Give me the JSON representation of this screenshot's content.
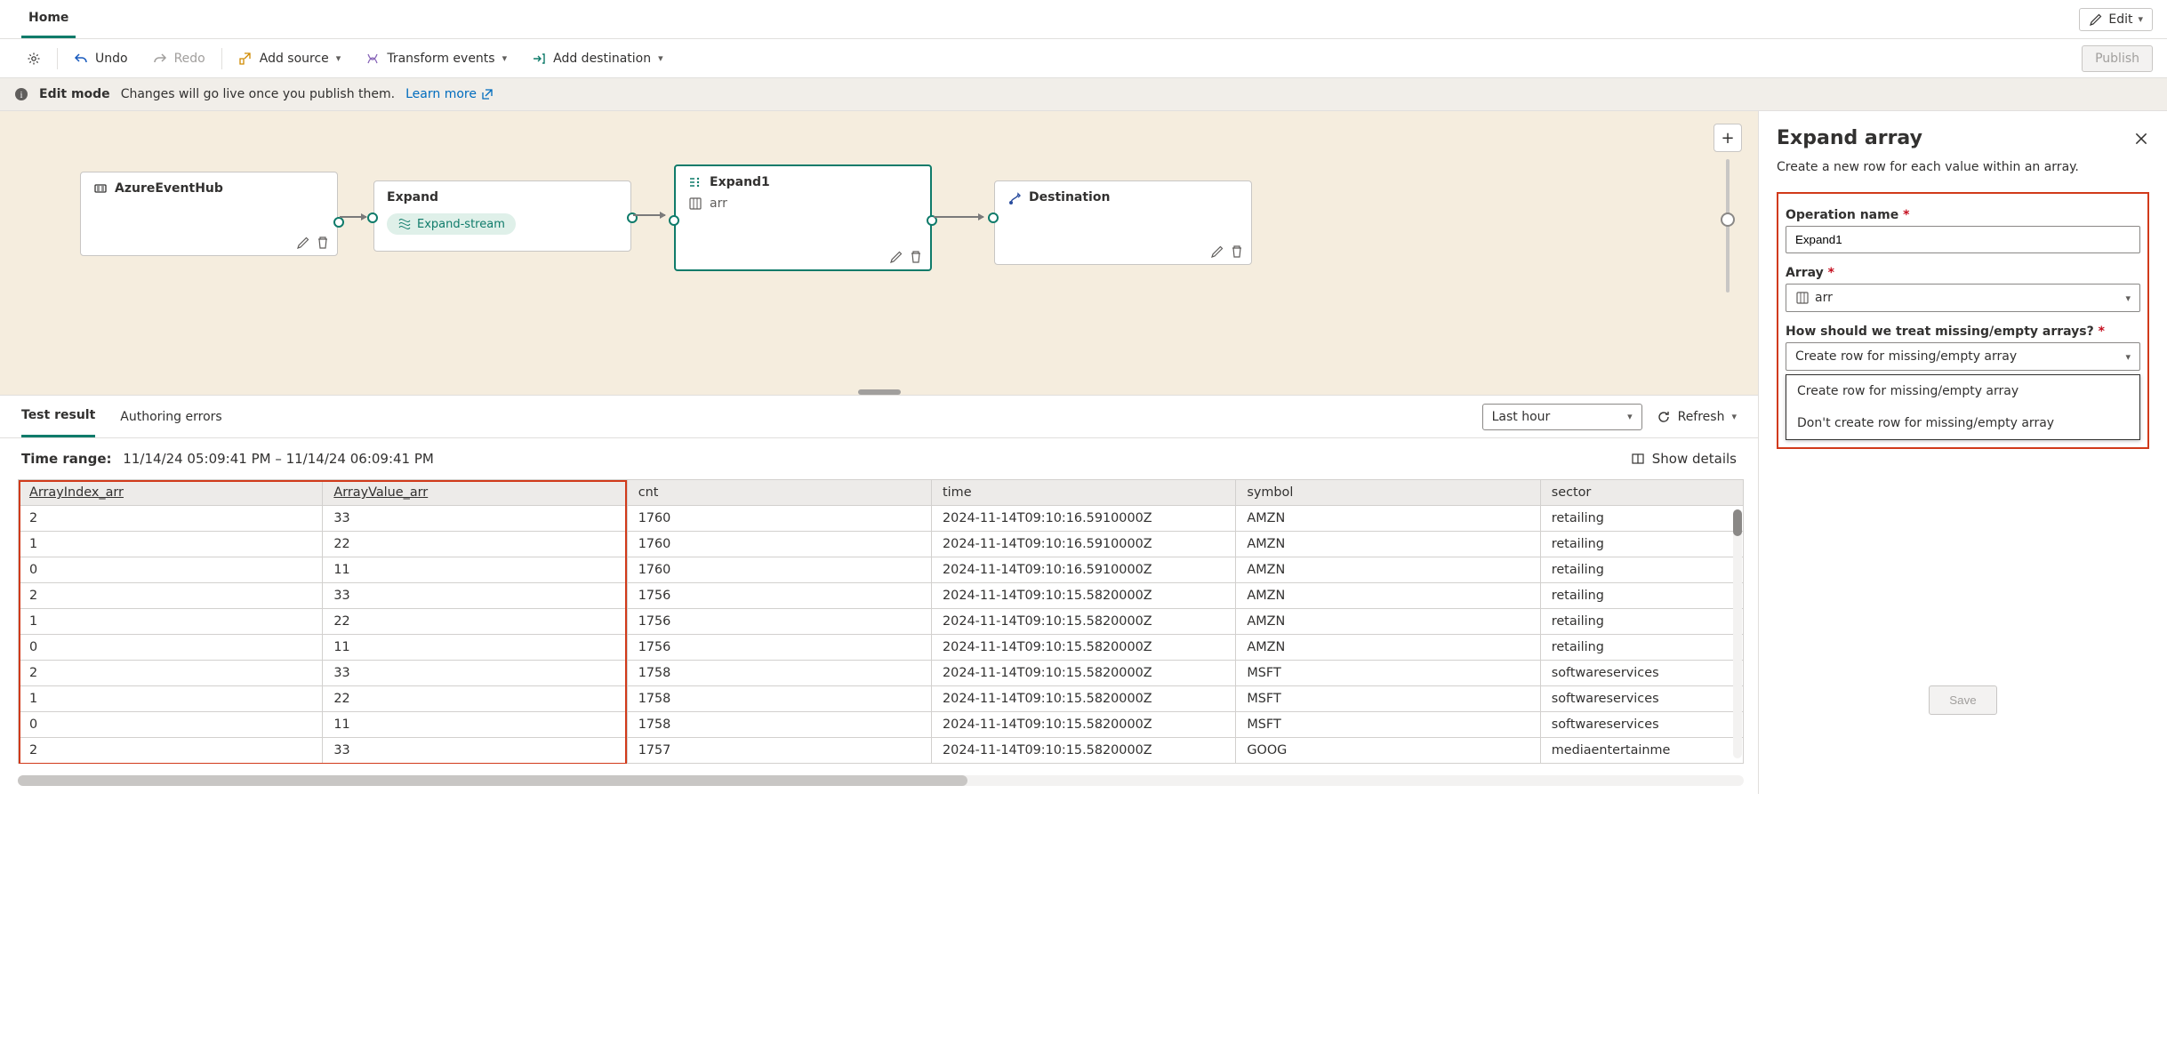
{
  "top": {
    "home_tab": "Home",
    "edit_btn": "Edit"
  },
  "cmd": {
    "undo": "Undo",
    "redo": "Redo",
    "add_source": "Add source",
    "transform": "Transform events",
    "add_dest": "Add destination",
    "publish": "Publish"
  },
  "banner": {
    "title": "Edit mode",
    "body": "Changes will go live once you publish them.",
    "learn_more": "Learn more"
  },
  "canvas": {
    "source": {
      "title": "AzureEventHub"
    },
    "expand_group": {
      "title": "Expand",
      "chip": "Expand-stream"
    },
    "expand1": {
      "title": "Expand1",
      "sub": "arr"
    },
    "destination": {
      "title": "Destination"
    }
  },
  "results": {
    "tabs": {
      "test": "Test result",
      "errors": "Authoring errors"
    },
    "time_select": "Last hour",
    "refresh": "Refresh",
    "time_label": "Time range:",
    "time_range": "11/14/24 05:09:41 PM – 11/14/24 06:09:41 PM",
    "show_details": "Show details",
    "columns": [
      "ArrayIndex_arr",
      "ArrayValue_arr",
      "cnt",
      "time",
      "symbol",
      "sector"
    ],
    "rows": [
      [
        "2",
        "33",
        "1760",
        "2024-11-14T09:10:16.5910000Z",
        "AMZN",
        "retailing"
      ],
      [
        "1",
        "22",
        "1760",
        "2024-11-14T09:10:16.5910000Z",
        "AMZN",
        "retailing"
      ],
      [
        "0",
        "11",
        "1760",
        "2024-11-14T09:10:16.5910000Z",
        "AMZN",
        "retailing"
      ],
      [
        "2",
        "33",
        "1756",
        "2024-11-14T09:10:15.5820000Z",
        "AMZN",
        "retailing"
      ],
      [
        "1",
        "22",
        "1756",
        "2024-11-14T09:10:15.5820000Z",
        "AMZN",
        "retailing"
      ],
      [
        "0",
        "11",
        "1756",
        "2024-11-14T09:10:15.5820000Z",
        "AMZN",
        "retailing"
      ],
      [
        "2",
        "33",
        "1758",
        "2024-11-14T09:10:15.5820000Z",
        "MSFT",
        "softwareservices"
      ],
      [
        "1",
        "22",
        "1758",
        "2024-11-14T09:10:15.5820000Z",
        "MSFT",
        "softwareservices"
      ],
      [
        "0",
        "11",
        "1758",
        "2024-11-14T09:10:15.5820000Z",
        "MSFT",
        "softwareservices"
      ],
      [
        "2",
        "33",
        "1757",
        "2024-11-14T09:10:15.5820000Z",
        "GOOG",
        "mediaentertainme"
      ]
    ]
  },
  "side": {
    "title": "Expand array",
    "desc": "Create a new row for each value within an array.",
    "op_label": "Operation name",
    "op_value": "Expand1",
    "array_label": "Array",
    "array_value": "arr",
    "empty_label": "How should we treat missing/empty arrays?",
    "empty_value": "Create row for missing/empty array",
    "options": [
      "Create row for missing/empty array",
      "Don't create row for missing/empty array"
    ],
    "save": "Save"
  }
}
